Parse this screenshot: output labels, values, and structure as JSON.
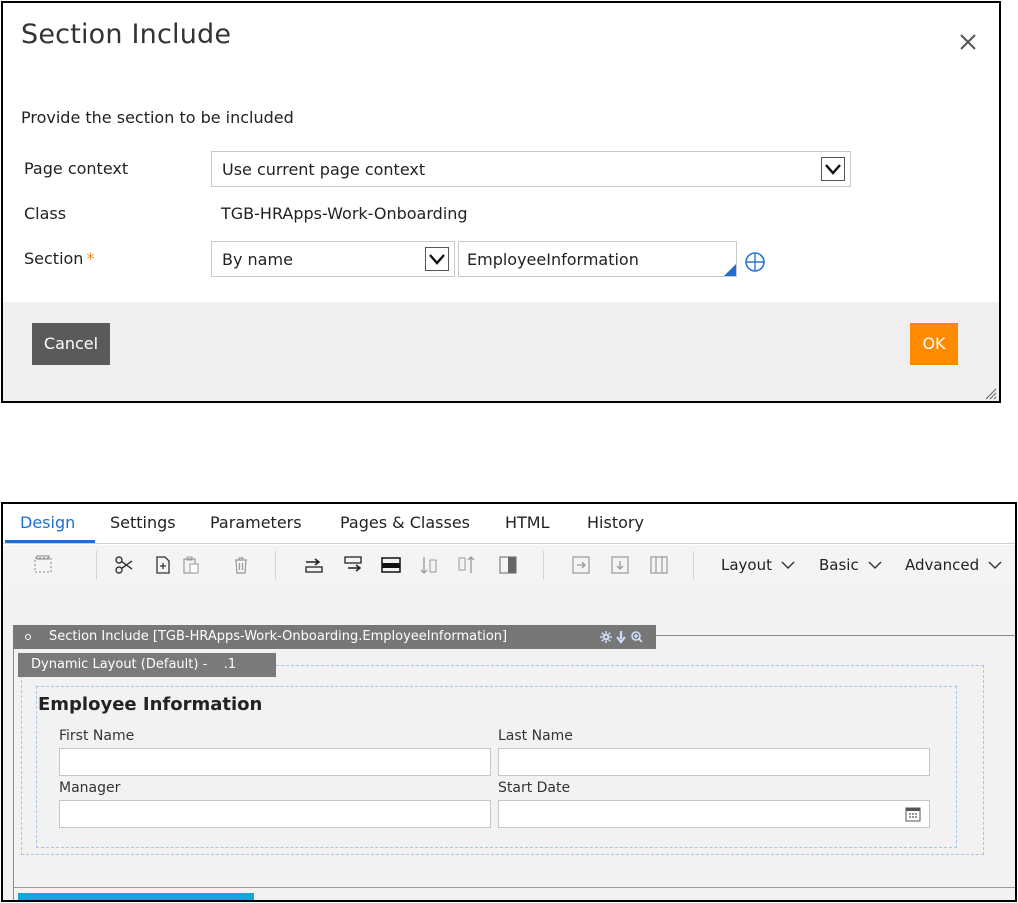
{
  "dialog": {
    "title": "Section Include",
    "subtitle": "Provide the section to be included",
    "page_context": {
      "label": "Page context",
      "selected": "Use current page context"
    },
    "class": {
      "label": "Class",
      "value": "TGB-HRApps-Work-Onboarding"
    },
    "section": {
      "label": "Section",
      "required_mark": "*",
      "mode_selected": "By name",
      "name_value": "EmployeeInformation"
    },
    "buttons": {
      "cancel": "Cancel",
      "ok": "OK"
    },
    "icons": {
      "close": "close-icon",
      "target": "crosshair-icon",
      "resize": "resize-grip-icon"
    }
  },
  "designer": {
    "tabs": [
      "Design",
      "Settings",
      "Parameters",
      "Pages & Classes",
      "HTML",
      "History"
    ],
    "active_tab": "Design",
    "toolbar": {
      "icons": [
        "section-icon",
        "cut-icon",
        "copy-icon",
        "paste-icon",
        "delete-icon",
        "insert-row-icon",
        "wrap-icon",
        "row-icon",
        "move-down-icon",
        "move-up-icon",
        "column-icon",
        "add-after-icon",
        "add-below-icon",
        "split-column-icon"
      ],
      "menus": [
        "Layout",
        "Basic",
        "Advanced"
      ]
    },
    "section_include_label": "Section Include [TGB-HRApps-Work-Onboarding.EmployeeInformation]",
    "dynamic_layout_label": "Dynamic Layout (Default) -    .1",
    "form": {
      "title": "Employee Information",
      "fields": [
        {
          "label": "First Name",
          "value": ""
        },
        {
          "label": "Last Name",
          "value": ""
        },
        {
          "label": "Manager",
          "value": ""
        },
        {
          "label": "Start Date",
          "value": ""
        }
      ]
    },
    "colors": {
      "accent": "#1d6fd6",
      "ok_button": "#ff8a00",
      "cancel_button": "#5a5a5a",
      "grid_strip": "#1aa4df"
    }
  }
}
